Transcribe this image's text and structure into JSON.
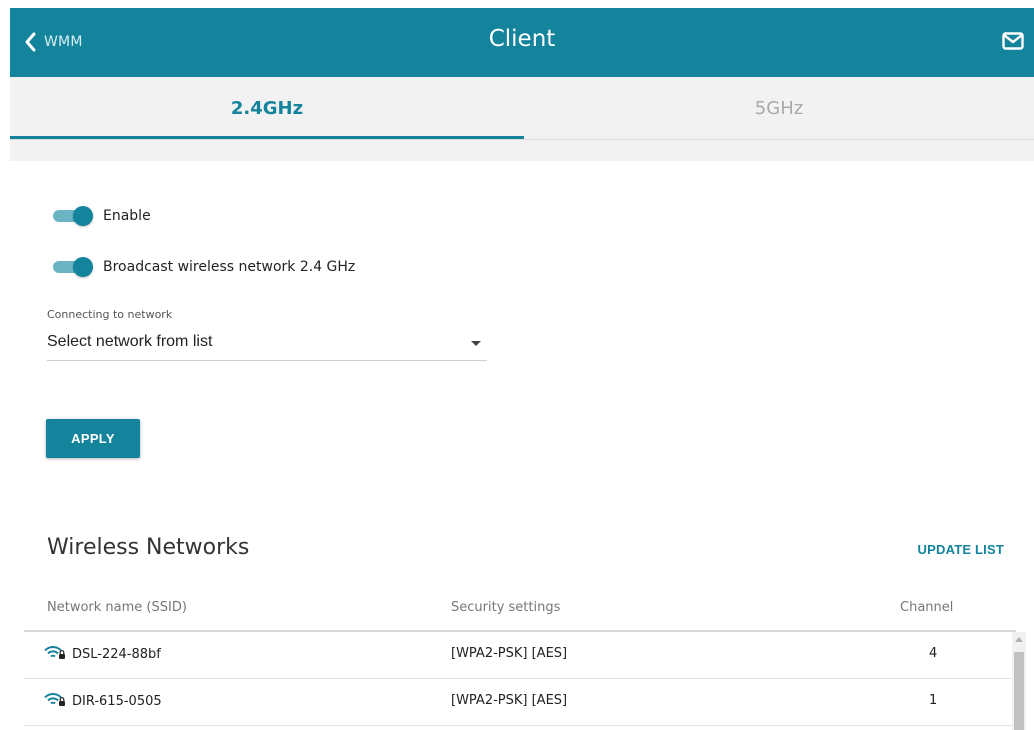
{
  "header": {
    "back_label": "WMM",
    "title": "Client",
    "mail_icon": "mail-icon"
  },
  "tabs": [
    {
      "label": "2.4GHz",
      "active": true
    },
    {
      "label": "5GHz",
      "active": false
    }
  ],
  "settings": {
    "enable_label": "Enable",
    "enable_on": true,
    "broadcast_label": "Broadcast wireless network 2.4 GHz",
    "broadcast_on": true,
    "connecting_caption": "Connecting to network",
    "connecting_value": "Select network from list",
    "apply_label": "APPLY"
  },
  "networks": {
    "title": "Wireless Networks",
    "update_label": "UPDATE LIST",
    "columns": [
      "Network name (SSID)",
      "Security settings",
      "Channel"
    ],
    "rows": [
      {
        "ssid": "DSL-224-88bf",
        "security": "[WPA2-PSK] [AES]",
        "channel": "4"
      },
      {
        "ssid": "DIR-615-0505",
        "security": "[WPA2-PSK] [AES]",
        "channel": "1"
      }
    ]
  },
  "colors": {
    "accent": "#14839c",
    "inactive_tab": "#a9a9a9",
    "background": "#f2f2f2"
  }
}
